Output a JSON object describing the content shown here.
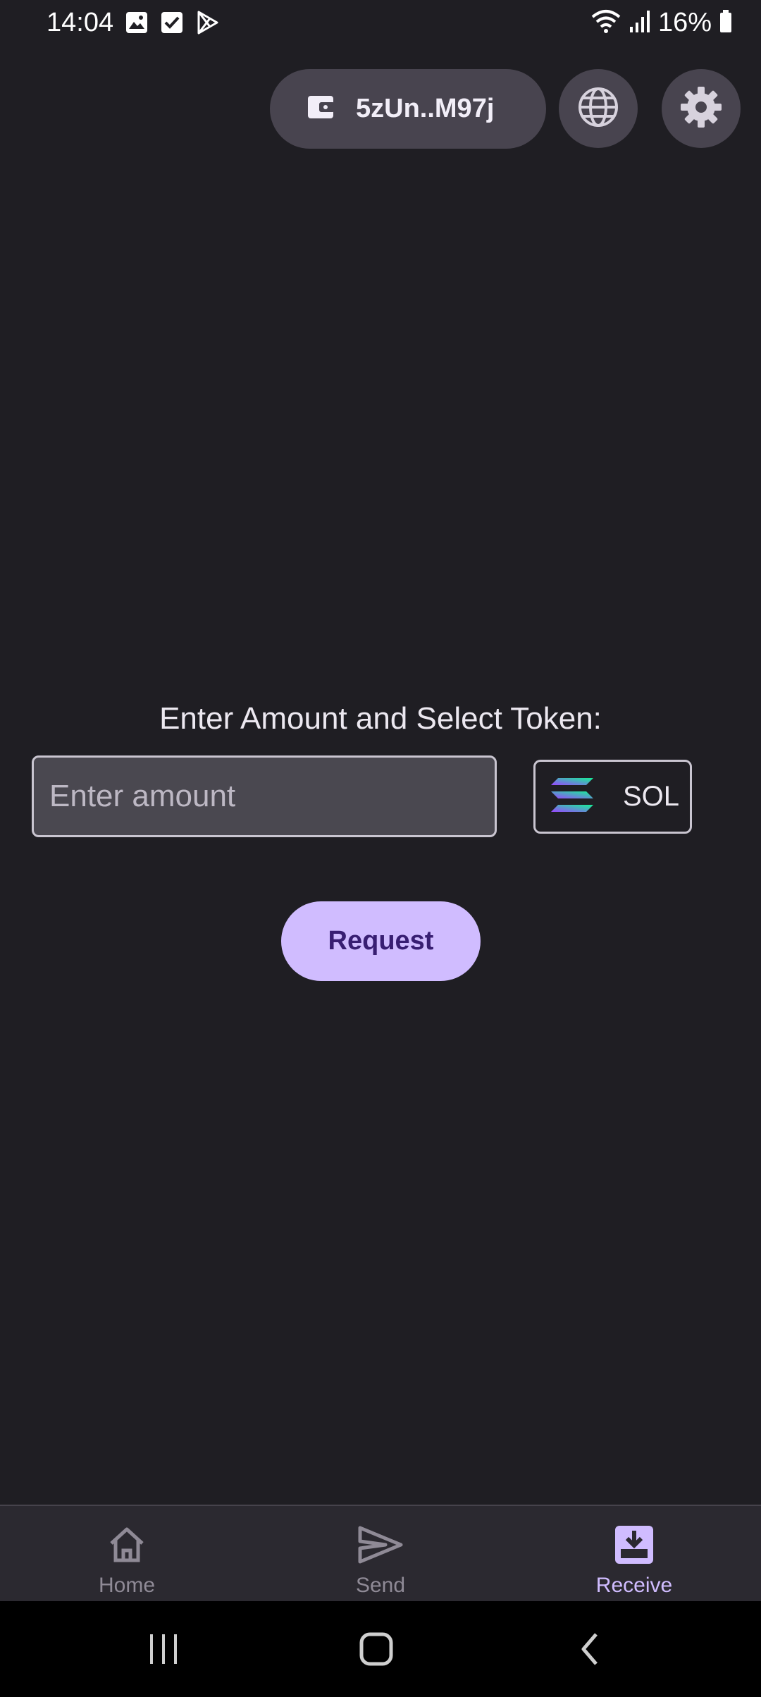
{
  "status_bar": {
    "time": "14:04",
    "battery": "16%",
    "left_icons": [
      "image-icon",
      "checkbox-icon",
      "play-store-icon"
    ],
    "right_icons": [
      "wifi-icon",
      "signal-icon",
      "battery-icon"
    ]
  },
  "header": {
    "wallet_address": "5zUn..M97j",
    "network_icon": "globe-icon",
    "settings_icon": "gear-icon"
  },
  "form": {
    "title": "Enter Amount and Select Token:",
    "amount_placeholder": "Enter amount",
    "amount_value": "",
    "token": "SOL",
    "request_label": "Request"
  },
  "bottom_nav": {
    "items": [
      {
        "label": "Home",
        "icon": "home-icon",
        "active": false
      },
      {
        "label": "Send",
        "icon": "send-icon",
        "active": false
      },
      {
        "label": "Receive",
        "icon": "receive-icon",
        "active": true
      }
    ]
  },
  "colors": {
    "background": "#1f1e23",
    "accent": "#d0bcff",
    "accent_text": "#381e72",
    "pill": "#48444f"
  }
}
